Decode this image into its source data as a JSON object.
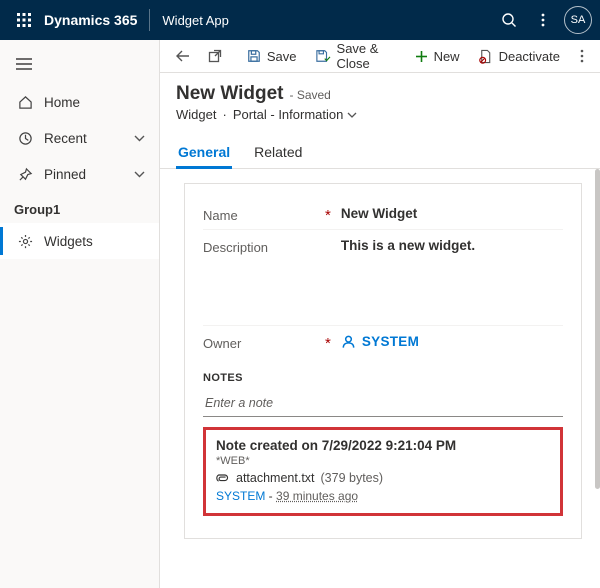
{
  "topbar": {
    "brand": "Dynamics 365",
    "app": "Widget App",
    "avatar": "SA"
  },
  "sidebar": {
    "home": "Home",
    "recent": "Recent",
    "pinned": "Pinned",
    "group_label": "Group1",
    "widgets": "Widgets"
  },
  "commandbar": {
    "save": "Save",
    "save_close": "Save & Close",
    "new": "New",
    "deactivate": "Deactivate"
  },
  "record": {
    "title": "New Widget",
    "status": "- Saved",
    "entity": "Widget",
    "form_name": "Portal - Information"
  },
  "tabs": {
    "general": "General",
    "related": "Related"
  },
  "fields": {
    "name_label": "Name",
    "name_value": "New Widget",
    "desc_label": "Description",
    "desc_value": "This is a new widget.",
    "owner_label": "Owner",
    "owner_value": "SYSTEM"
  },
  "notes": {
    "section": "NOTES",
    "placeholder": "Enter a note",
    "title": "Note created on 7/29/2022 9:21:04 PM",
    "tag": "*WEB*",
    "attachment_name": "attachment.txt",
    "attachment_meta": "(379 bytes)",
    "author": "SYSTEM",
    "sep": " - ",
    "ago": "39 minutes ago"
  }
}
